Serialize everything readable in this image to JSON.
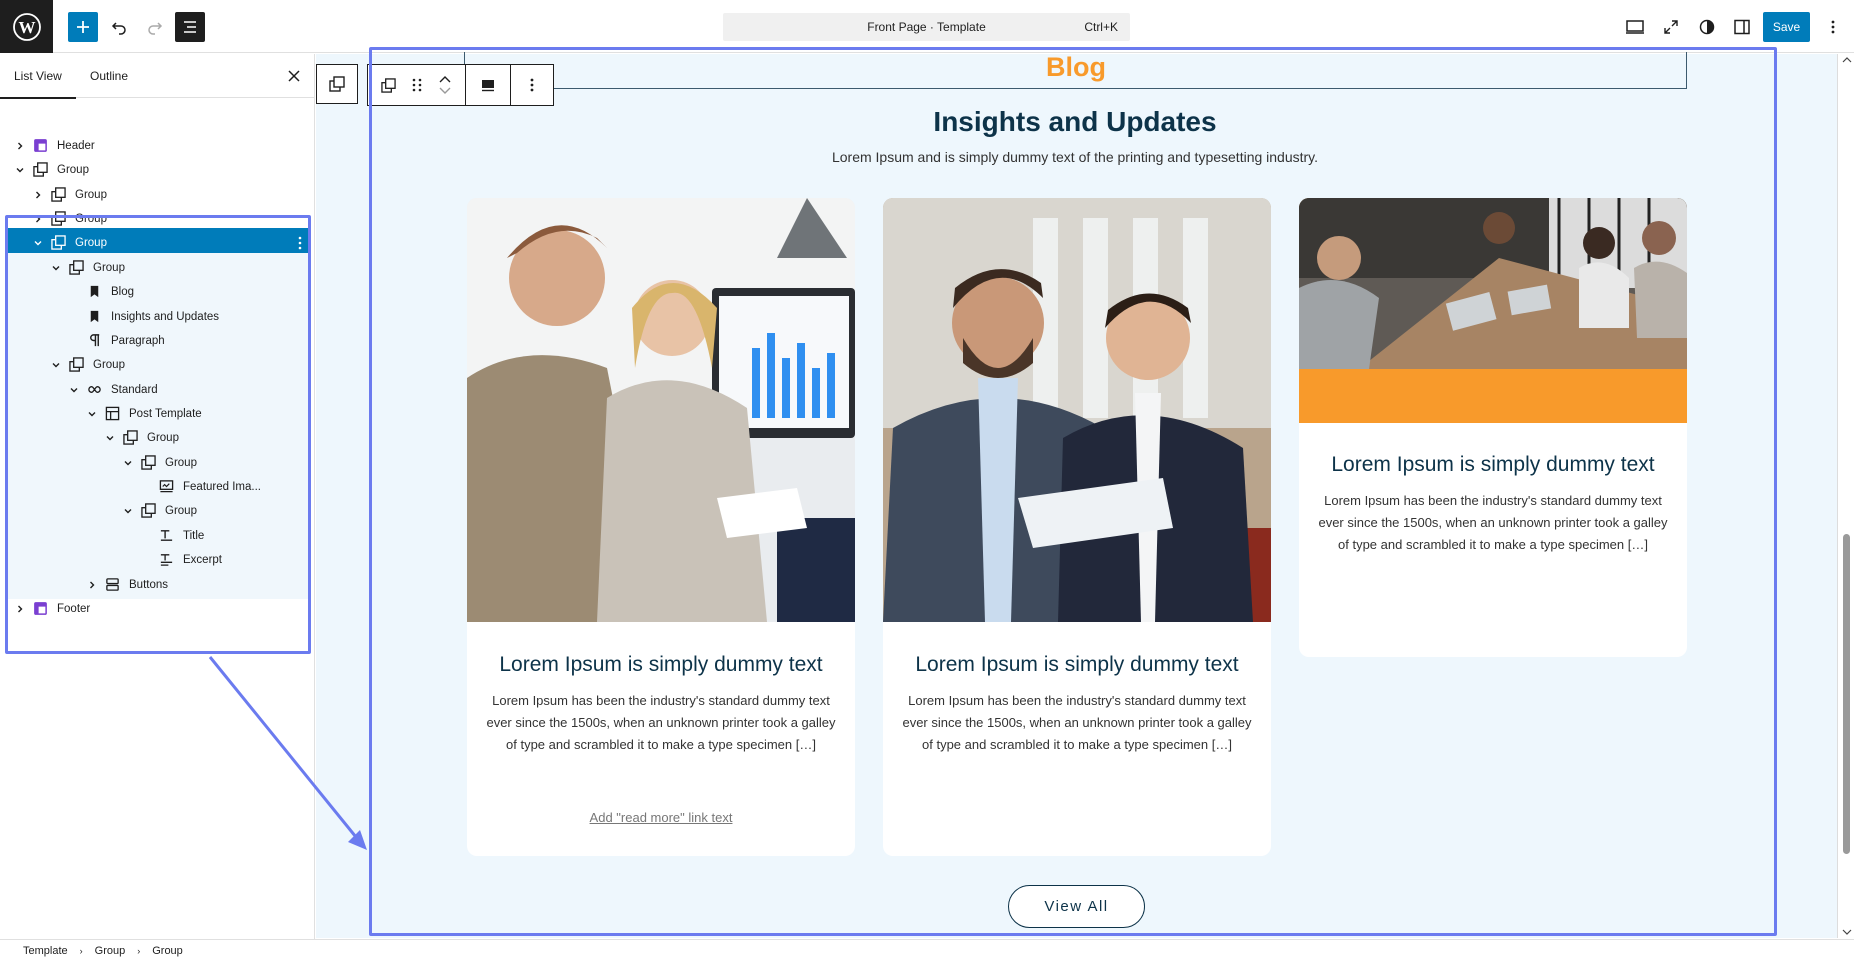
{
  "topbar": {
    "command_title": "Front Page · Template",
    "command_shortcut": "Ctrl+K",
    "save_label": "Save"
  },
  "sidebar": {
    "tabs": [
      {
        "label": "List View",
        "active": true
      },
      {
        "label": "Outline",
        "active": false
      }
    ],
    "tree": [
      {
        "label": "Header",
        "icon": "template-part-icon",
        "expanded": false
      },
      {
        "label": "Group",
        "icon": "group-icon",
        "expanded": true
      },
      {
        "label": "Group",
        "icon": "group-icon",
        "expanded": false
      },
      {
        "label": "Group",
        "icon": "group-icon",
        "expanded": false
      },
      {
        "label": "Group",
        "icon": "group-icon",
        "expanded": true,
        "selected": true
      },
      {
        "label": "Group",
        "icon": "group-icon",
        "expanded": true
      },
      {
        "label": "Blog",
        "icon": "bookmark-icon"
      },
      {
        "label": "Insights and Updates",
        "icon": "bookmark-icon"
      },
      {
        "label": "Paragraph",
        "icon": "paragraph-icon"
      },
      {
        "label": "Group",
        "icon": "group-icon",
        "expanded": true
      },
      {
        "label": "Standard",
        "icon": "loop-icon",
        "expanded": true
      },
      {
        "label": "Post Template",
        "icon": "layout-icon",
        "expanded": true
      },
      {
        "label": "Group",
        "icon": "group-icon",
        "expanded": true
      },
      {
        "label": "Group",
        "icon": "group-icon",
        "expanded": true
      },
      {
        "label": "Featured Ima...",
        "icon": "featured-image-icon"
      },
      {
        "label": "Group",
        "icon": "group-icon",
        "expanded": true
      },
      {
        "label": "Title",
        "icon": "title-icon"
      },
      {
        "label": "Excerpt",
        "icon": "excerpt-icon"
      },
      {
        "label": "Buttons",
        "icon": "buttons-icon",
        "expanded": false
      },
      {
        "label": "Footer",
        "icon": "template-part-icon",
        "expanded": false
      }
    ]
  },
  "breadcrumb": [
    "Template",
    "Group",
    "Group"
  ],
  "canvas": {
    "blog_label": "Blog",
    "title": "Insights and Updates",
    "subtitle": "Lorem Ipsum and is simply dummy text of the printing and typesetting industry.",
    "cards": [
      {
        "title": "Lorem Ipsum is simply dummy text",
        "excerpt": "Lorem Ipsum has been the industry's standard dummy text ever since the 1500s, when an unknown printer took a galley of type and scrambled it to make a type specimen […]",
        "read_more": "Add \"read more\" link text"
      },
      {
        "title": "Lorem Ipsum is simply dummy text",
        "excerpt": "Lorem Ipsum has been the industry's standard dummy text ever since the 1500s, when an unknown printer took a galley of type and scrambled it to make a type specimen […]"
      },
      {
        "title": "Lorem Ipsum is simply dummy text",
        "excerpt": "Lorem Ipsum has been the industry's standard dummy text ever since the 1500s, when an unknown printer took a galley of type and scrambled it to make a type specimen […]"
      }
    ],
    "view_all": "View All"
  },
  "colors": {
    "accent": "#007cba",
    "orange": "#f89a2b",
    "navy": "#0d3349",
    "highlight": "#6b7bef"
  }
}
